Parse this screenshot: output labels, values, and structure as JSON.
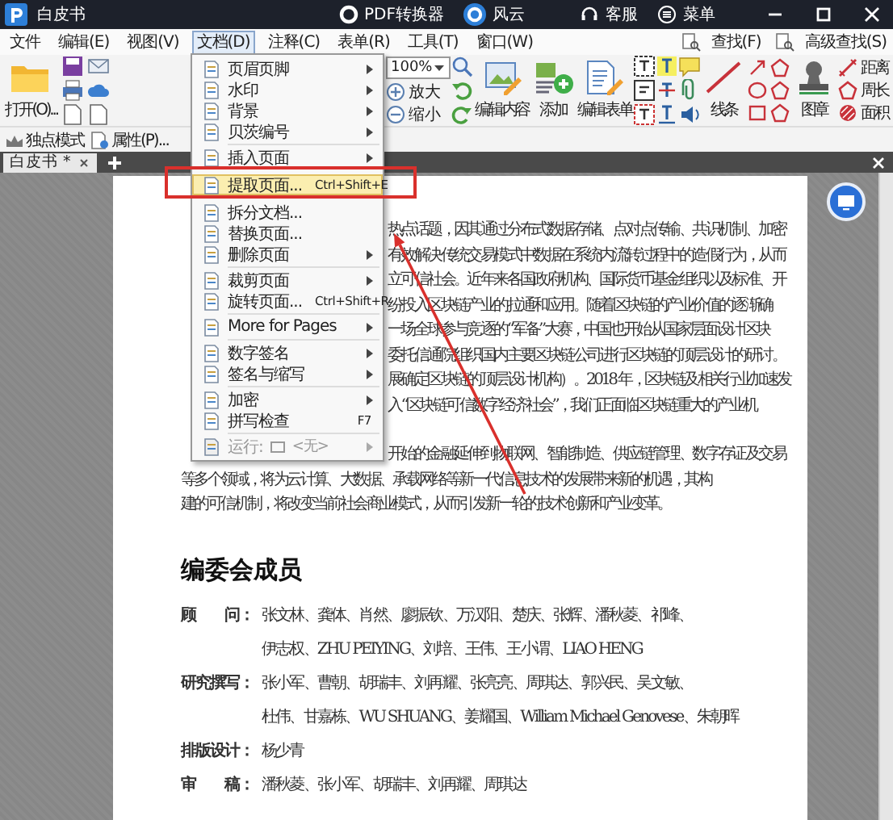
{
  "window": {
    "title": "白皮书",
    "center_items": [
      "PDF转换器",
      "风云"
    ],
    "right_items": [
      "客服",
      "菜单"
    ]
  },
  "menu_bar": {
    "items": [
      {
        "label": "文件",
        "selected": false
      },
      {
        "label": "编辑(E)",
        "selected": false
      },
      {
        "label": "视图(V)",
        "selected": false
      },
      {
        "label": "文档(D)",
        "selected": true
      },
      {
        "label": "注释(C)",
        "selected": false
      },
      {
        "label": "表单(R)",
        "selected": false
      },
      {
        "label": "工具(T)",
        "selected": false
      },
      {
        "label": "窗口(W)",
        "selected": false
      }
    ],
    "right_buttons": [
      "查找(F)",
      "高级查找(S)"
    ]
  },
  "ribbon": {
    "open_label": "打开(O)...",
    "zoom_value": "100%",
    "zoom_in": "放大",
    "zoom_out": "缩小",
    "tools": [
      "编辑内容",
      "添加",
      "编辑表单"
    ],
    "line_tool": "线条",
    "stamp_tool": "图章",
    "measure": [
      "距离",
      "周长",
      "面积"
    ]
  },
  "quick_bar": [
    "独点模式",
    "属性(P)..."
  ],
  "doc_tabs": [
    {
      "label": "白皮书 *",
      "selected": true
    }
  ],
  "dropdown": {
    "groups": [
      [
        {
          "label": "页眉页脚",
          "submenu": true,
          "selected": false,
          "disabled": false
        },
        {
          "label": "水印",
          "submenu": true,
          "selected": false,
          "disabled": false
        },
        {
          "label": "背景",
          "submenu": true,
          "selected": false,
          "disabled": false
        },
        {
          "label": "贝茨编号",
          "submenu": true,
          "selected": false,
          "disabled": false
        }
      ],
      [
        {
          "label": "插入页面",
          "submenu": true,
          "selected": false,
          "disabled": false
        },
        {
          "label": "提取页面...",
          "shortcut": "Ctrl+Shift+E",
          "submenu": false,
          "selected": true,
          "disabled": false
        },
        {
          "label": "拆分文档...",
          "submenu": false,
          "selected": false,
          "disabled": false
        },
        {
          "label": "替换页面...",
          "submenu": false,
          "selected": false,
          "disabled": false
        },
        {
          "label": "删除页面",
          "submenu": true,
          "selected": false,
          "disabled": false
        }
      ],
      [
        {
          "label": "裁剪页面",
          "submenu": true,
          "selected": false,
          "disabled": false
        },
        {
          "label": "旋转页面...",
          "shortcut": "Ctrl+Shift+R",
          "submenu": false,
          "selected": false,
          "disabled": false
        }
      ],
      [
        {
          "label": "More for Pages",
          "submenu": true,
          "selected": false,
          "disabled": false
        }
      ],
      [
        {
          "label": "数字签名",
          "submenu": true,
          "selected": false,
          "disabled": false
        },
        {
          "label": "签名与缩写",
          "submenu": true,
          "selected": false,
          "disabled": false
        }
      ],
      [
        {
          "label": "加密",
          "submenu": true,
          "selected": false,
          "disabled": false
        },
        {
          "label": "拼写检查",
          "shortcut": "F7",
          "submenu": false,
          "selected": false,
          "disabled": false
        }
      ],
      [
        {
          "label": "运行:",
          "value": "<无>",
          "submenu": true,
          "selected": false,
          "disabled": true
        }
      ]
    ]
  },
  "page": {
    "covered_lines": [
      "热点话题，因其通过分布式数据存储、点对点传输、共识机制、加密",
      "有效解决传统交易模式中数据在系统内流转过程中的造假行为，从而",
      "立可信社会。近年来各国政府机构、国际货币基金组织以及标准、开",
      "纷投入区块链产业的拉通和应用。随着区块链的产业价值的逐渐确",
      "一场全球参与竞逐的“军备”大赛，中国也开始从国家层面设计区块",
      "委托信通院组织国内主要区块链公司进行区块链的顶层设计的研讨。",
      "展确定区块链的顶层设计机构）。2018 年，区块链及相关行业加速发",
      "入“区块链可信数字经济社会”，我们正面临区块链重大的产业机"
    ],
    "second_paragraph": [
      "开始的金融延伸到物联网、智能制造、供应链管理、数字存证及交易",
      "等多个领域，将为云计算、大数据、承载网络等新一代信息技术的发展带来新的机遇，其构",
      "建的可信机制，将改变当前社会商业模式，从而引发新一轮的技术创新和产业变革。"
    ],
    "heading": "编委会成员",
    "members": [
      {
        "role": "顾　　问：",
        "lines": [
          "张文林、龚体、肖然、廖振钦、万汉阳、楚庆、张辉、潘秋菱、祁峰、",
          "伊志权、ZHU PEIYING、刘培、王伟、王小谓、LIAO HENG"
        ]
      },
      {
        "role": "研究撰写：",
        "lines": [
          "张小军、曹朝、胡瑞丰、刘再耀、张亮亮、周琪达、郭兴民、吴文敏、",
          "杜伟、甘嘉栋、WU SHUANG、姜耀国、William Michael Genovese、朱朝晖"
        ]
      },
      {
        "role": "排版设计：",
        "lines": [
          "杨少青"
        ]
      },
      {
        "role": "审　　稿：",
        "lines": [
          "潘秋菱、张小军、胡瑞丰、刘再耀、周琪达"
        ]
      }
    ]
  }
}
